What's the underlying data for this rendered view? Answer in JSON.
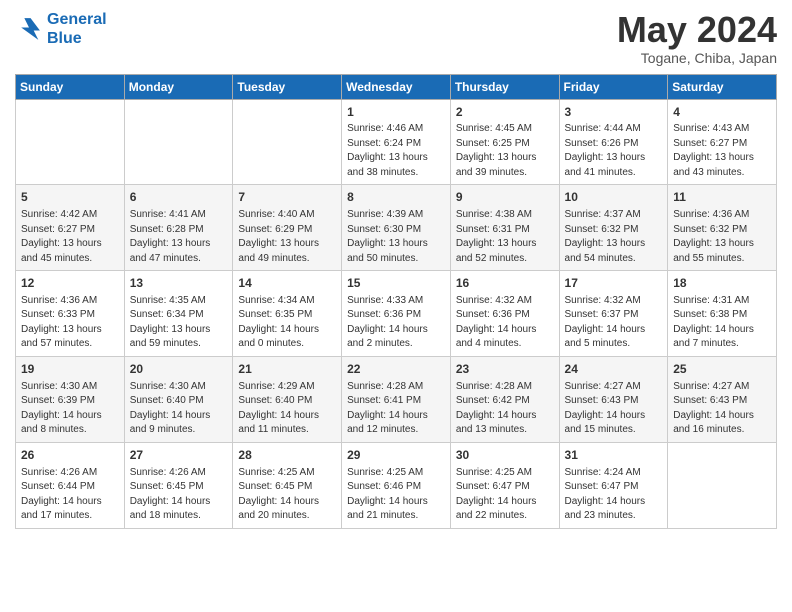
{
  "header": {
    "logo_line1": "General",
    "logo_line2": "Blue",
    "month": "May 2024",
    "location": "Togane, Chiba, Japan"
  },
  "weekdays": [
    "Sunday",
    "Monday",
    "Tuesday",
    "Wednesday",
    "Thursday",
    "Friday",
    "Saturday"
  ],
  "rows": [
    [
      {
        "day": "",
        "info": ""
      },
      {
        "day": "",
        "info": ""
      },
      {
        "day": "",
        "info": ""
      },
      {
        "day": "1",
        "info": "Sunrise: 4:46 AM\nSunset: 6:24 PM\nDaylight: 13 hours\nand 38 minutes."
      },
      {
        "day": "2",
        "info": "Sunrise: 4:45 AM\nSunset: 6:25 PM\nDaylight: 13 hours\nand 39 minutes."
      },
      {
        "day": "3",
        "info": "Sunrise: 4:44 AM\nSunset: 6:26 PM\nDaylight: 13 hours\nand 41 minutes."
      },
      {
        "day": "4",
        "info": "Sunrise: 4:43 AM\nSunset: 6:27 PM\nDaylight: 13 hours\nand 43 minutes."
      }
    ],
    [
      {
        "day": "5",
        "info": "Sunrise: 4:42 AM\nSunset: 6:27 PM\nDaylight: 13 hours\nand 45 minutes."
      },
      {
        "day": "6",
        "info": "Sunrise: 4:41 AM\nSunset: 6:28 PM\nDaylight: 13 hours\nand 47 minutes."
      },
      {
        "day": "7",
        "info": "Sunrise: 4:40 AM\nSunset: 6:29 PM\nDaylight: 13 hours\nand 49 minutes."
      },
      {
        "day": "8",
        "info": "Sunrise: 4:39 AM\nSunset: 6:30 PM\nDaylight: 13 hours\nand 50 minutes."
      },
      {
        "day": "9",
        "info": "Sunrise: 4:38 AM\nSunset: 6:31 PM\nDaylight: 13 hours\nand 52 minutes."
      },
      {
        "day": "10",
        "info": "Sunrise: 4:37 AM\nSunset: 6:32 PM\nDaylight: 13 hours\nand 54 minutes."
      },
      {
        "day": "11",
        "info": "Sunrise: 4:36 AM\nSunset: 6:32 PM\nDaylight: 13 hours\nand 55 minutes."
      }
    ],
    [
      {
        "day": "12",
        "info": "Sunrise: 4:36 AM\nSunset: 6:33 PM\nDaylight: 13 hours\nand 57 minutes."
      },
      {
        "day": "13",
        "info": "Sunrise: 4:35 AM\nSunset: 6:34 PM\nDaylight: 13 hours\nand 59 minutes."
      },
      {
        "day": "14",
        "info": "Sunrise: 4:34 AM\nSunset: 6:35 PM\nDaylight: 14 hours\nand 0 minutes."
      },
      {
        "day": "15",
        "info": "Sunrise: 4:33 AM\nSunset: 6:36 PM\nDaylight: 14 hours\nand 2 minutes."
      },
      {
        "day": "16",
        "info": "Sunrise: 4:32 AM\nSunset: 6:36 PM\nDaylight: 14 hours\nand 4 minutes."
      },
      {
        "day": "17",
        "info": "Sunrise: 4:32 AM\nSunset: 6:37 PM\nDaylight: 14 hours\nand 5 minutes."
      },
      {
        "day": "18",
        "info": "Sunrise: 4:31 AM\nSunset: 6:38 PM\nDaylight: 14 hours\nand 7 minutes."
      }
    ],
    [
      {
        "day": "19",
        "info": "Sunrise: 4:30 AM\nSunset: 6:39 PM\nDaylight: 14 hours\nand 8 minutes."
      },
      {
        "day": "20",
        "info": "Sunrise: 4:30 AM\nSunset: 6:40 PM\nDaylight: 14 hours\nand 9 minutes."
      },
      {
        "day": "21",
        "info": "Sunrise: 4:29 AM\nSunset: 6:40 PM\nDaylight: 14 hours\nand 11 minutes."
      },
      {
        "day": "22",
        "info": "Sunrise: 4:28 AM\nSunset: 6:41 PM\nDaylight: 14 hours\nand 12 minutes."
      },
      {
        "day": "23",
        "info": "Sunrise: 4:28 AM\nSunset: 6:42 PM\nDaylight: 14 hours\nand 13 minutes."
      },
      {
        "day": "24",
        "info": "Sunrise: 4:27 AM\nSunset: 6:43 PM\nDaylight: 14 hours\nand 15 minutes."
      },
      {
        "day": "25",
        "info": "Sunrise: 4:27 AM\nSunset: 6:43 PM\nDaylight: 14 hours\nand 16 minutes."
      }
    ],
    [
      {
        "day": "26",
        "info": "Sunrise: 4:26 AM\nSunset: 6:44 PM\nDaylight: 14 hours\nand 17 minutes."
      },
      {
        "day": "27",
        "info": "Sunrise: 4:26 AM\nSunset: 6:45 PM\nDaylight: 14 hours\nand 18 minutes."
      },
      {
        "day": "28",
        "info": "Sunrise: 4:25 AM\nSunset: 6:45 PM\nDaylight: 14 hours\nand 20 minutes."
      },
      {
        "day": "29",
        "info": "Sunrise: 4:25 AM\nSunset: 6:46 PM\nDaylight: 14 hours\nand 21 minutes."
      },
      {
        "day": "30",
        "info": "Sunrise: 4:25 AM\nSunset: 6:47 PM\nDaylight: 14 hours\nand 22 minutes."
      },
      {
        "day": "31",
        "info": "Sunrise: 4:24 AM\nSunset: 6:47 PM\nDaylight: 14 hours\nand 23 minutes."
      },
      {
        "day": "",
        "info": ""
      }
    ]
  ]
}
